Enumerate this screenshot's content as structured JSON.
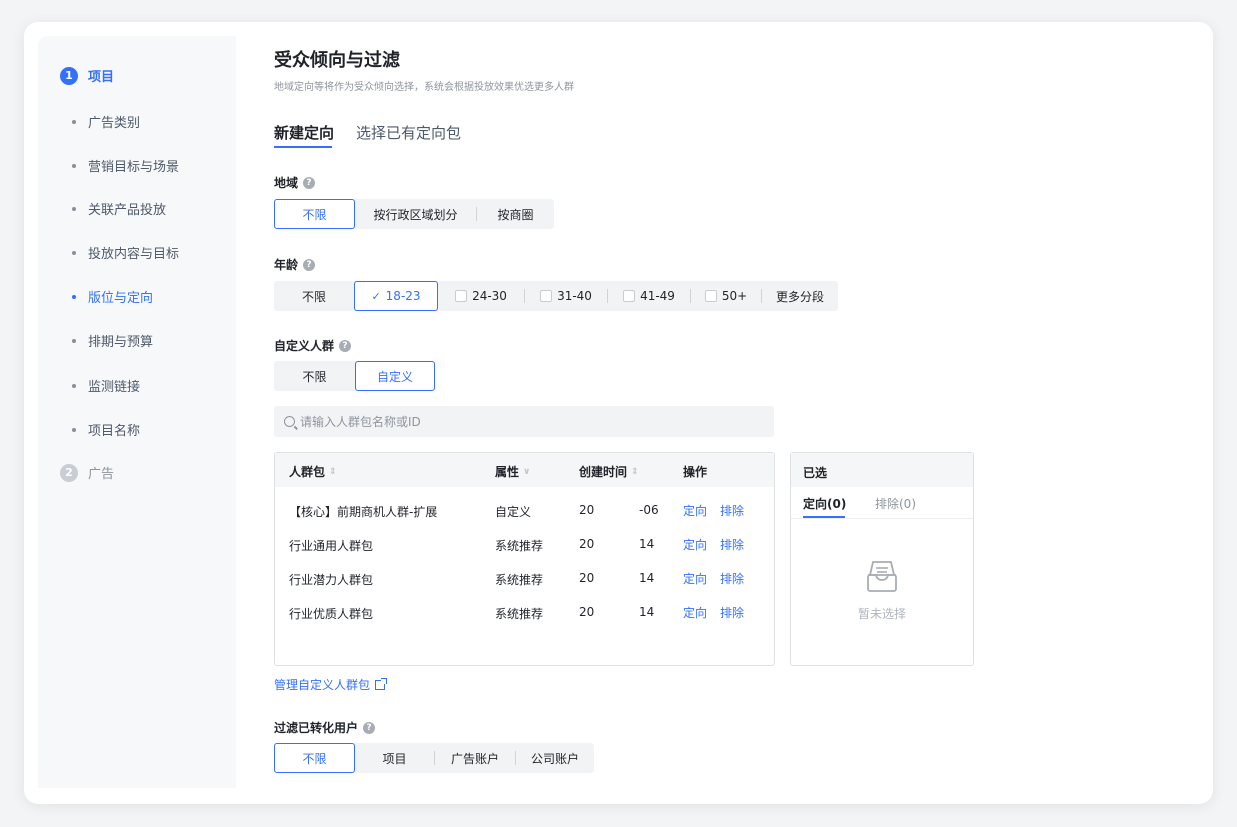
{
  "sidebar": {
    "step1": {
      "num": "1",
      "label": "项目"
    },
    "items": [
      "广告类别",
      "营销目标与场景",
      "关联产品投放",
      "投放内容与目标",
      "版位与定向",
      "排期与预算",
      "监测链接",
      "项目名称"
    ],
    "active_index": 4,
    "step2": {
      "num": "2",
      "label": "广告"
    }
  },
  "header": {
    "title": "受众倾向与过滤",
    "subtitle": "地域定向等将作为受众倾向选择，系统会根据投放效果优选更多人群"
  },
  "tabs": [
    "新建定向",
    "选择已有定向包"
  ],
  "region": {
    "label": "地域",
    "options": [
      "不限",
      "按行政区域划分",
      "按商圈"
    ],
    "selected": "不限"
  },
  "age": {
    "label": "年龄",
    "options": [
      "不限",
      "18-23",
      "24-30",
      "31-40",
      "41-49",
      "50+",
      "更多分段"
    ],
    "selected": "18-23"
  },
  "custom_audience": {
    "label": "自定义人群",
    "options": [
      "不限",
      "自定义"
    ],
    "selected": "自定义",
    "search_placeholder": "请输入人群包名称或ID",
    "columns": [
      "人群包",
      "属性",
      "创建时间",
      "操作"
    ],
    "rows": [
      {
        "name": "【核心】前期商机人群-扩展",
        "attr": "自定义",
        "date_start": "20",
        "date_end": "-06",
        "action1": "定向",
        "action2": "排除"
      },
      {
        "name": "行业通用人群包",
        "attr": "系统推荐",
        "date_start": "20",
        "date_end": "14",
        "action1": "定向",
        "action2": "排除"
      },
      {
        "name": "行业潜力人群包",
        "attr": "系统推荐",
        "date_start": "20",
        "date_end": "14",
        "action1": "定向",
        "action2": "排除"
      },
      {
        "name": "行业优质人群包",
        "attr": "系统推荐",
        "date_start": "20",
        "date_end": "14",
        "action1": "定向",
        "action2": "排除"
      }
    ],
    "selected_panel": {
      "title": "已选",
      "tab1": "定向(0)",
      "tab2": "排除(0)",
      "empty_text": "暂未选择"
    },
    "manage_link": "管理自定义人群包"
  },
  "filter_converted": {
    "label": "过滤已转化用户",
    "options": [
      "不限",
      "项目",
      "广告账户",
      "公司账户"
    ],
    "selected": "不限"
  },
  "colors": {
    "accent": "#3370ff",
    "text": "#1f2329",
    "muted": "#8f959e"
  }
}
